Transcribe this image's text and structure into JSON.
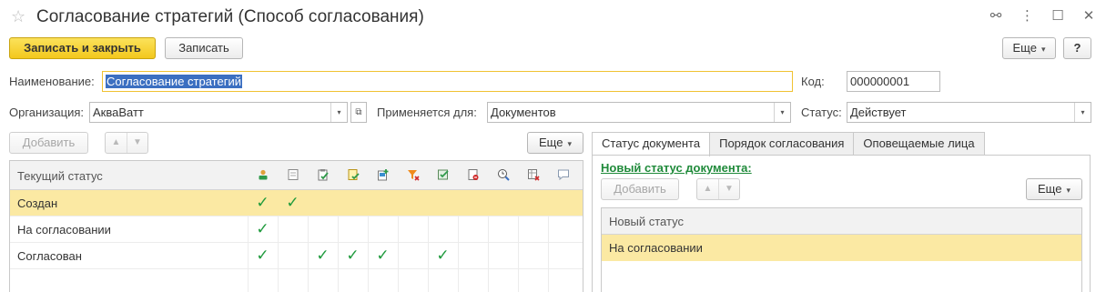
{
  "window": {
    "title": "Согласование стратегий (Способ согласования)",
    "star": "☆",
    "icons": [
      "link-icon",
      "more-vertical-icon",
      "maximize-icon",
      "close-icon"
    ],
    "icon_glyphs": {
      "link": "⚯",
      "more": "⋮",
      "maximize": "☐",
      "close": "✕"
    }
  },
  "toolbar": {
    "save_close_label": "Записать и закрыть",
    "save_label": "Записать",
    "more_label": "Еще",
    "help_label": "?"
  },
  "form": {
    "name_label": "Наименование:",
    "name_value": "Согласование стратегий",
    "code_label": "Код:",
    "code_value": "000000001",
    "org_label": "Организация:",
    "org_value": "АкваВатт",
    "applies_label": "Применяется для:",
    "applies_value": "Документов",
    "status_label": "Статус:",
    "status_value": "Действует"
  },
  "left": {
    "add_label": "Добавить",
    "more_label": "Еще",
    "column_header": "Текущий статус",
    "icon_columns": [
      "user-icon",
      "document-icon",
      "document-edit-icon",
      "document-approve-icon",
      "document-add-icon",
      "filter-remove-icon",
      "document-check-icon",
      "document-cancel-icon",
      "clock-search-icon",
      "table-delete-icon",
      "comment-icon"
    ],
    "rows": [
      {
        "status": "Создан",
        "checks": [
          true,
          true,
          false,
          false,
          false,
          false,
          false,
          false,
          false,
          false,
          false
        ],
        "selected": true
      },
      {
        "status": "На согласовании",
        "checks": [
          true,
          false,
          false,
          false,
          false,
          false,
          false,
          false,
          false,
          false,
          false
        ],
        "selected": false
      },
      {
        "status": "Согласован",
        "checks": [
          true,
          false,
          true,
          true,
          true,
          false,
          true,
          false,
          false,
          false,
          false
        ],
        "selected": false
      }
    ],
    "check_glyph": "✓"
  },
  "right": {
    "tabs": [
      "Статус документа",
      "Порядок согласования",
      "Оповещаемые лица"
    ],
    "active_tab": 0,
    "section_link": "Новый статус документа:",
    "add_label": "Добавить",
    "more_label": "Еще",
    "column_header": "Новый статус",
    "rows": [
      "На согласовании"
    ]
  },
  "colors": {
    "accent_yellow": "#f3c81d",
    "selected_row": "#fbe9a3",
    "check_green": "#1e9a3c",
    "link_green": "#1f8a3a",
    "selection_blue": "#3b6fc1"
  }
}
